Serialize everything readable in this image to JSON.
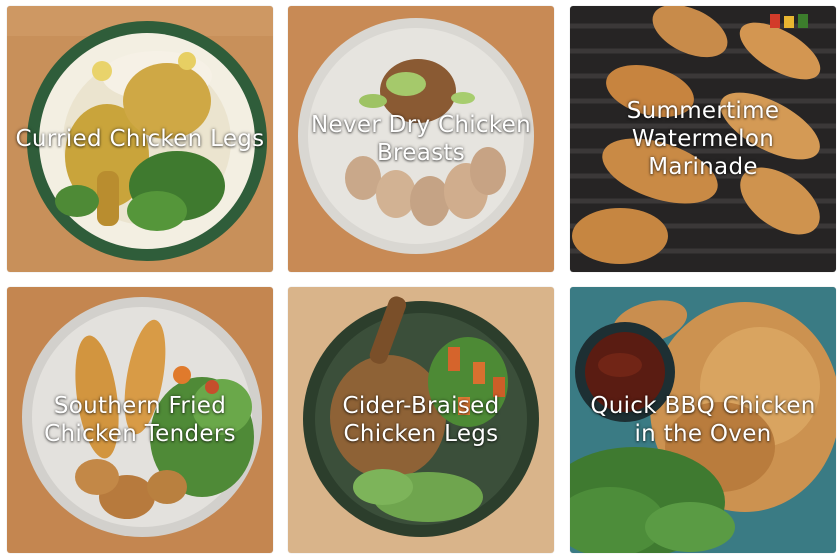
{
  "recipes": [
    {
      "title": "Curried Chicken Legs"
    },
    {
      "title": "Never Dry Chicken Breasts"
    },
    {
      "title": "Summertime Watermelon Marinade"
    },
    {
      "title": "Southern Fried Chicken Tenders"
    },
    {
      "title": "Cider-Braised Chicken Legs"
    },
    {
      "title": "Quick BBQ Chicken in the Oven"
    }
  ]
}
